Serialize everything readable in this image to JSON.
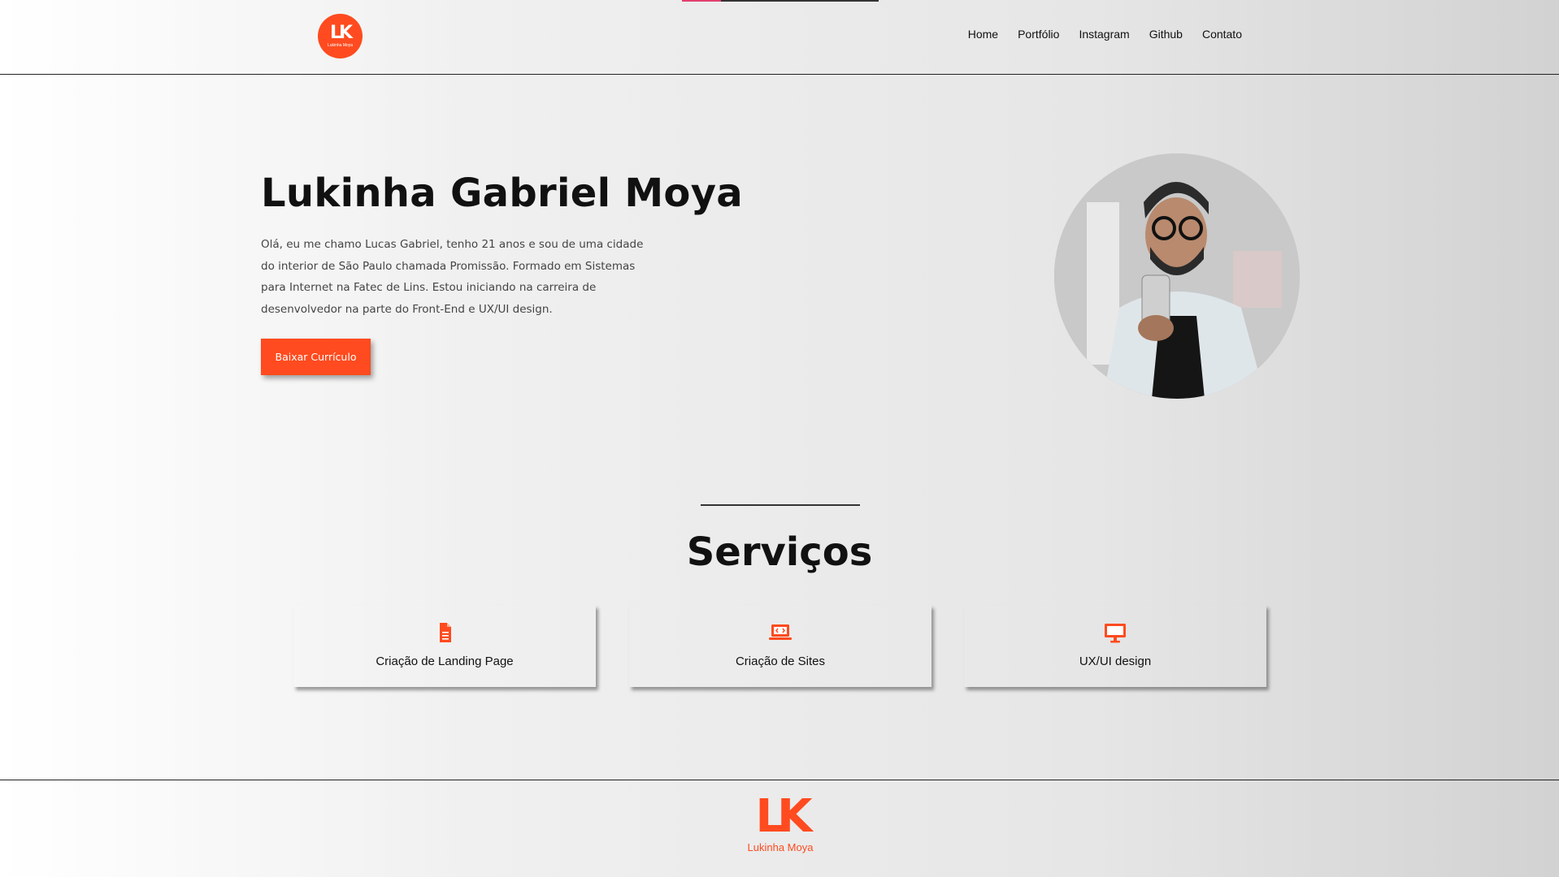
{
  "brand": {
    "badge_mark": "LK",
    "badge_caption": "Lukinha Moya",
    "footer_mark": "LK",
    "footer_name": "Lukinha Moya",
    "accent_color": "#ff4b1f"
  },
  "nav": {
    "items": [
      "Home",
      "Portfólio",
      "Instagram",
      "Github",
      "Contato"
    ]
  },
  "hero": {
    "title": "Lukinha Gabriel Moya",
    "bio": "Olá, eu me chamo Lucas Gabriel, tenho 21 anos e sou de uma cidade do interior de São Paulo chamada Promissão. Formado em Sistemas para Internet na Fatec de Lins. Estou iniciando na carreira de desenvolvedor na parte do Front-End e UX/UI design.",
    "cta_label": "Baixar Currículo"
  },
  "services": {
    "title": "Serviços",
    "cards": [
      {
        "label": "Criação de Landing Page",
        "icon": "document-icon"
      },
      {
        "label": "Criação de Sites",
        "icon": "laptop-code-icon"
      },
      {
        "label": "UX/UI design",
        "icon": "desktop-icon"
      }
    ]
  }
}
